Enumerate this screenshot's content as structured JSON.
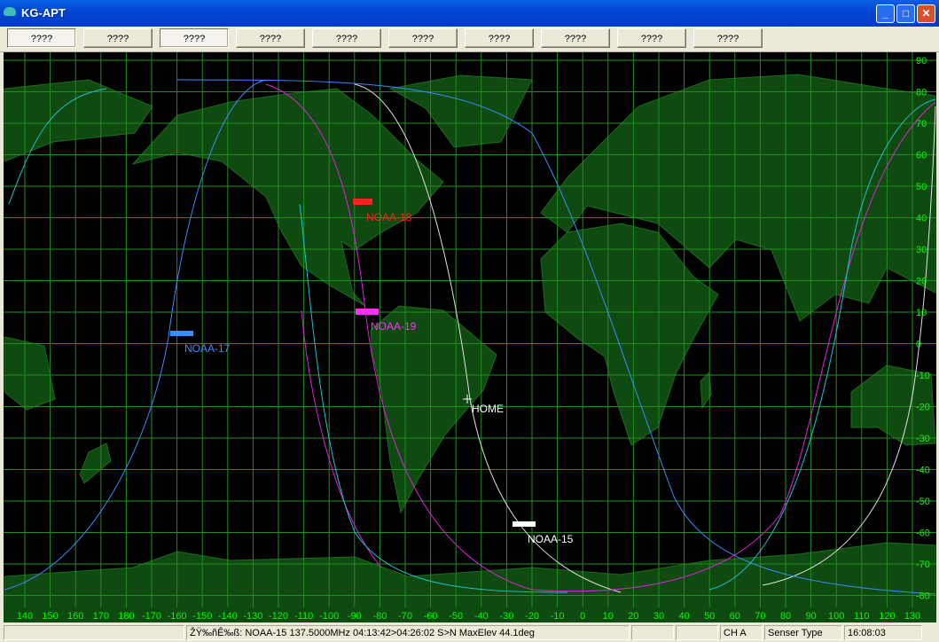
{
  "window": {
    "title": "KG-APT",
    "minimize": "_",
    "maximize": "□",
    "close": "✕"
  },
  "toolbar": {
    "buttons": [
      "????",
      "????",
      "????",
      "????",
      "????",
      "????",
      "????",
      "????",
      "????",
      "????"
    ]
  },
  "map": {
    "lat_labels": [
      "90",
      "80",
      "70",
      "60",
      "50",
      "40",
      "30",
      "20",
      "10",
      "0",
      "-10",
      "-20",
      "-30",
      "-40",
      "-50",
      "-60",
      "-70",
      "-80"
    ],
    "lon_labels": [
      "140",
      "150",
      "160",
      "170",
      "180",
      "-170",
      "-160",
      "-150",
      "-140",
      "-130",
      "-120",
      "-110",
      "-100",
      "-90",
      "-80",
      "-70",
      "-60",
      "-50",
      "-40",
      "-30",
      "-20",
      "-10",
      "0",
      "10",
      "20",
      "30",
      "40",
      "50",
      "60",
      "70",
      "80",
      "90",
      "100",
      "110",
      "120",
      "130"
    ],
    "satellites": [
      {
        "name": "NOAA-18",
        "color": "#ff2020"
      },
      {
        "name": "NOAA-19",
        "color": "#ff30ff"
      },
      {
        "name": "NOAA-17",
        "color": "#3a8cff"
      },
      {
        "name": "NOAA-15",
        "color": "#ffffff"
      }
    ],
    "home": "HOME",
    "colors": {
      "land": "#0f4a10",
      "grid": "#1f8f1f",
      "label": "#00ff00"
    }
  },
  "status": {
    "panels": [
      "",
      "ŽŸ‰ñÊ‰ß: NOAA-15 137.5000MHz 04:13:42>04:26:02 S>N MaxElev 44.1deg",
      "",
      "",
      "CH A",
      "Senser Type",
      "16:08:03"
    ]
  }
}
